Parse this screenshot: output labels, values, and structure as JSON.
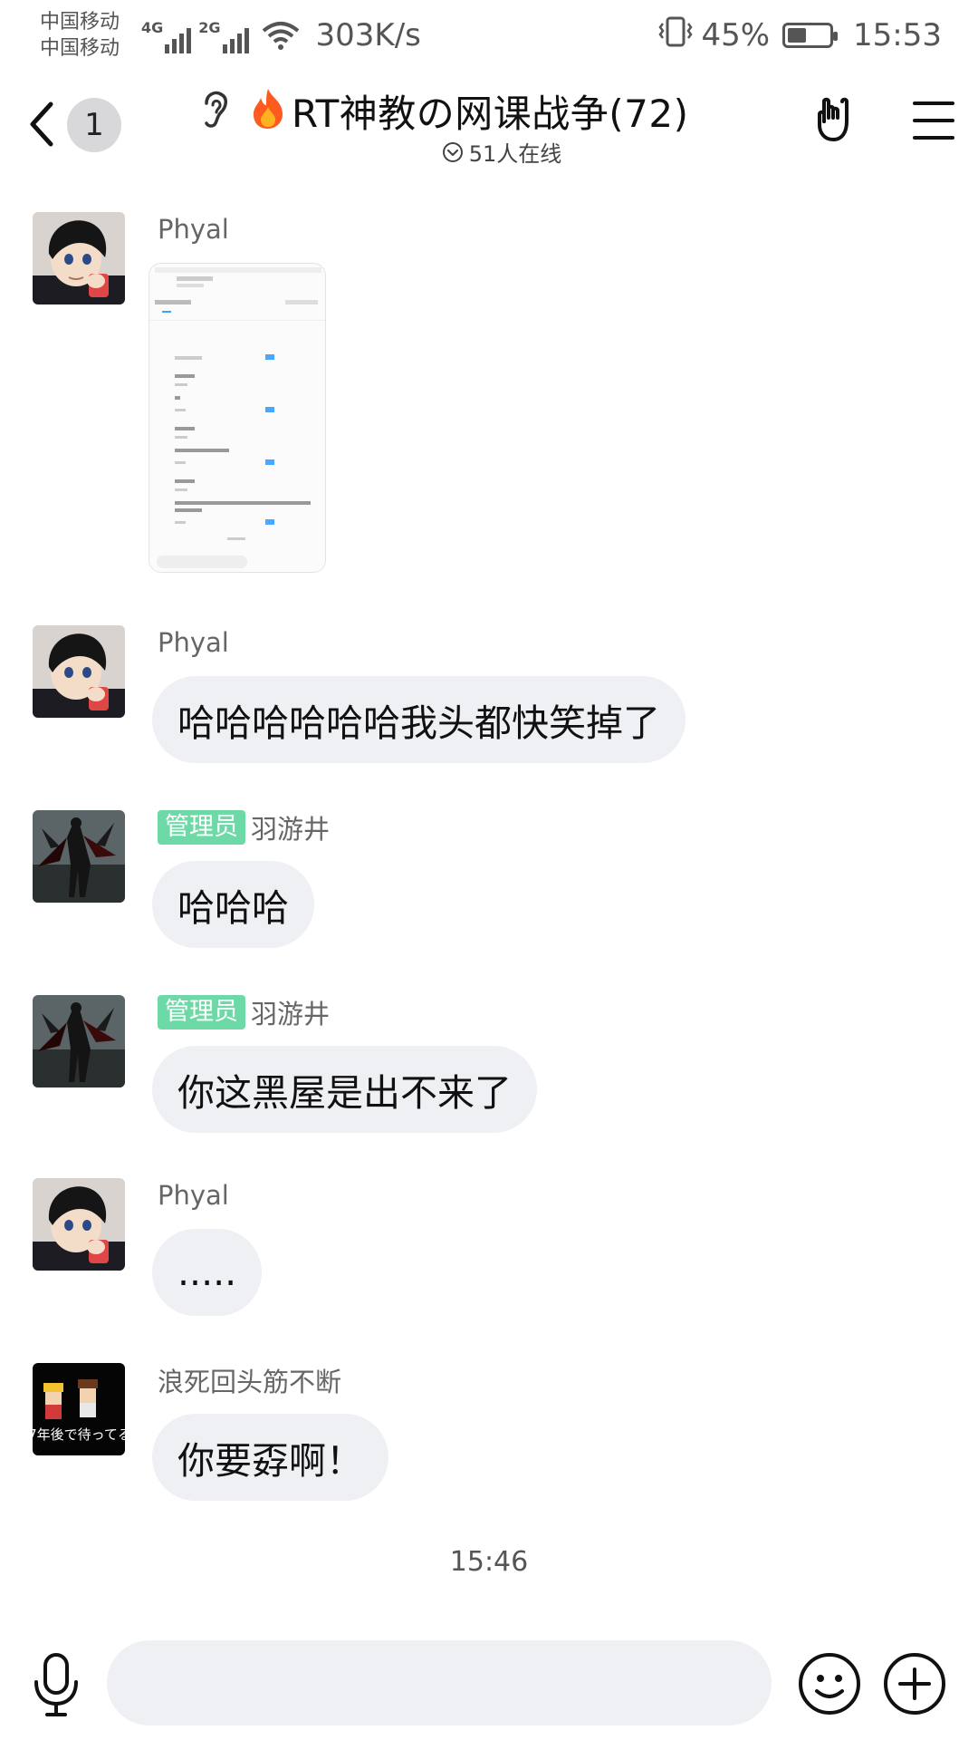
{
  "status_bar": {
    "carrier_1": "中国移动",
    "carrier_2": "中国移动",
    "network_1": "4G",
    "network_2": "2G",
    "speed": "303K/s",
    "battery": "45%",
    "battery_level": 0.45,
    "time": "15:53"
  },
  "header": {
    "unread_count": "1",
    "title": "RT神教の网课战争(72)",
    "online": "51人在线"
  },
  "messages": [
    {
      "sender": "Phyal",
      "type": "image",
      "avatar": "conan-avatar"
    },
    {
      "sender": "Phyal",
      "type": "text",
      "text": "哈哈哈哈哈哈我头都快笑掉了",
      "avatar": "conan-avatar"
    },
    {
      "sender": "羽游井",
      "badge": "管理员",
      "type": "text",
      "text": "哈哈哈",
      "avatar": "dark-figure-avatar"
    },
    {
      "sender": "羽游井",
      "badge": "管理员",
      "type": "text",
      "text": "你这黑屋是出不来了",
      "avatar": "dark-figure-avatar"
    },
    {
      "sender": "Phyal",
      "type": "text",
      "text": ".....",
      "avatar": "conan-avatar"
    },
    {
      "sender": "浪死回头筋不断",
      "type": "text",
      "text": "你要孬啊！",
      "avatar": "pixel-duo-avatar"
    }
  ],
  "avatar_text": "7年後で待ってる",
  "time_divider": "15:46",
  "input": {
    "value": "",
    "placeholder": ""
  },
  "colors": {
    "bubble": "#eef0f4",
    "admin_badge": "#6cd9a6",
    "fire": "#ff5a1f"
  }
}
